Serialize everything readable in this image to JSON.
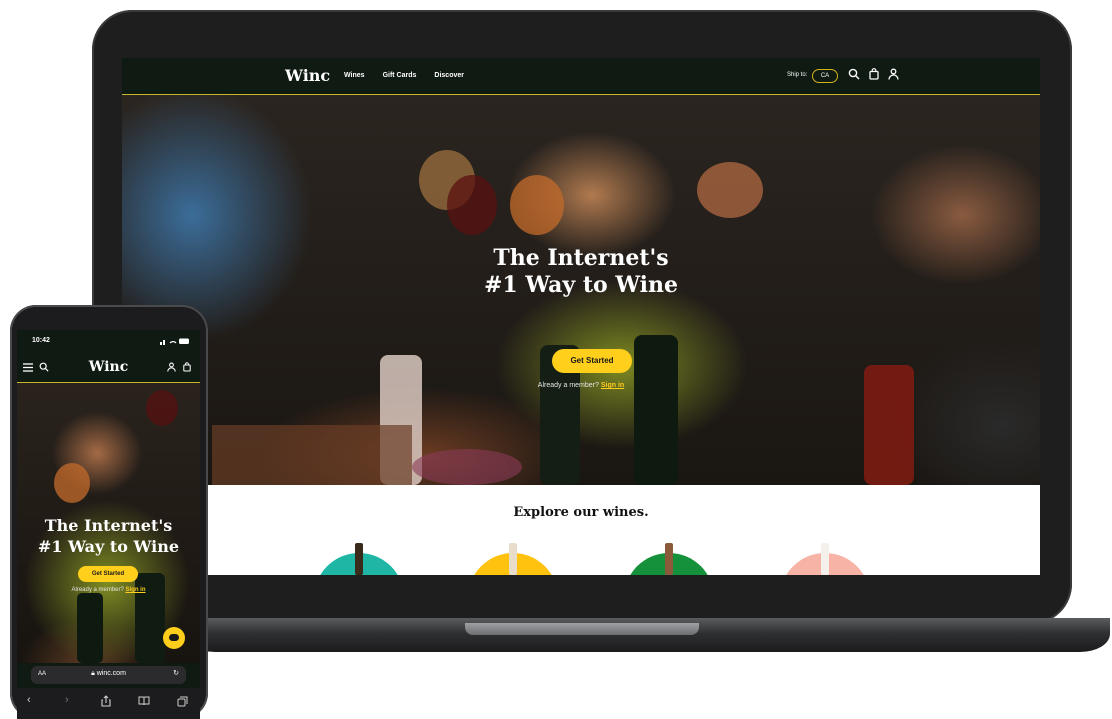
{
  "laptop": {
    "nav": {
      "logo": "Winc",
      "menu": [
        "Wines",
        "Gift Cards",
        "Discover"
      ],
      "ship_to_label": "Ship to:",
      "ship_to_value": "CA"
    },
    "hero": {
      "title_line1": "The Internet's",
      "title_line2": "#1 Way to Wine",
      "cta": "Get Started",
      "member_text": "Already a member?",
      "member_link": "Sign in"
    },
    "explore": {
      "title": "Explore our wines."
    }
  },
  "phone": {
    "status_time": "10:42",
    "logo": "Winc",
    "hero": {
      "title_line1": "The Internet's",
      "title_line2": "#1 Way to Wine",
      "cta": "Get Started",
      "member_text": "Already a member?",
      "member_link": "Sign in"
    },
    "urlbar": {
      "aa": "AA",
      "url": "winc.com"
    }
  },
  "colors": {
    "accent": "#ffcf1b",
    "nav_bg": "#0f1a13",
    "nav_line": "#c9b62a"
  },
  "icons": [
    "search-icon",
    "bag-icon",
    "user-icon",
    "menu-icon",
    "lock-icon",
    "reload-icon",
    "chat-icon"
  ]
}
